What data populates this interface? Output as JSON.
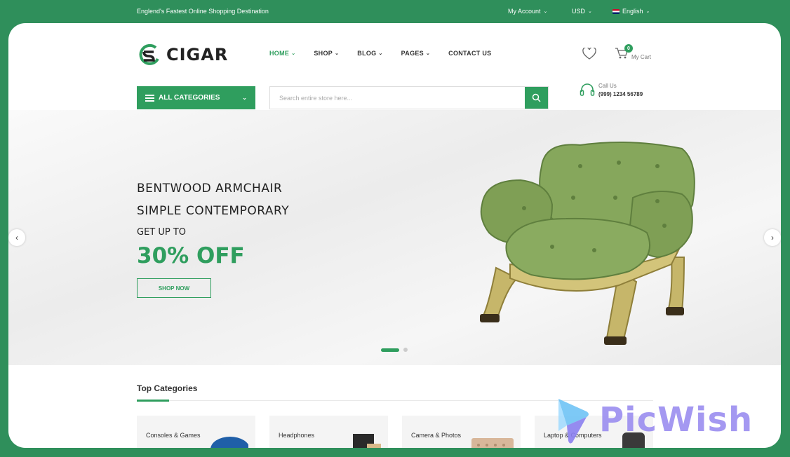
{
  "topbar": {
    "tagline": "Englend's Fastest Online Shopping Destination",
    "account": "My Account",
    "currency": "USD",
    "language": "English"
  },
  "header": {
    "logo_text": "CIGAR",
    "nav": [
      "HOME",
      "SHOP",
      "BLOG",
      "PAGES",
      "CONTACT US"
    ],
    "cart_count": "0",
    "cart_label": "My Cart",
    "categories_label": "ALL CATEGORIES",
    "search_placeholder": "Search entire store here...",
    "call_label": "Call Us",
    "call_phone": "(999) 1234 56789"
  },
  "hero": {
    "line1": "BENTWOOD ARMCHAIR",
    "line2": "SIMPLE CONTEMPORARY",
    "line3": "GET UP TO",
    "discount": "30% OFF",
    "button": "SHOP NOW",
    "prev": "‹",
    "next": "›"
  },
  "categories": {
    "title": "Top Categories",
    "items": [
      "Consoles & Games",
      "Headphones",
      "Camera & Photos",
      "Laptop & Computers"
    ]
  },
  "watermark": {
    "text": "PicWish"
  },
  "colors": {
    "accent": "#2f9e5e",
    "frame": "#2f8f5b",
    "watermark": "#9b8df0"
  }
}
